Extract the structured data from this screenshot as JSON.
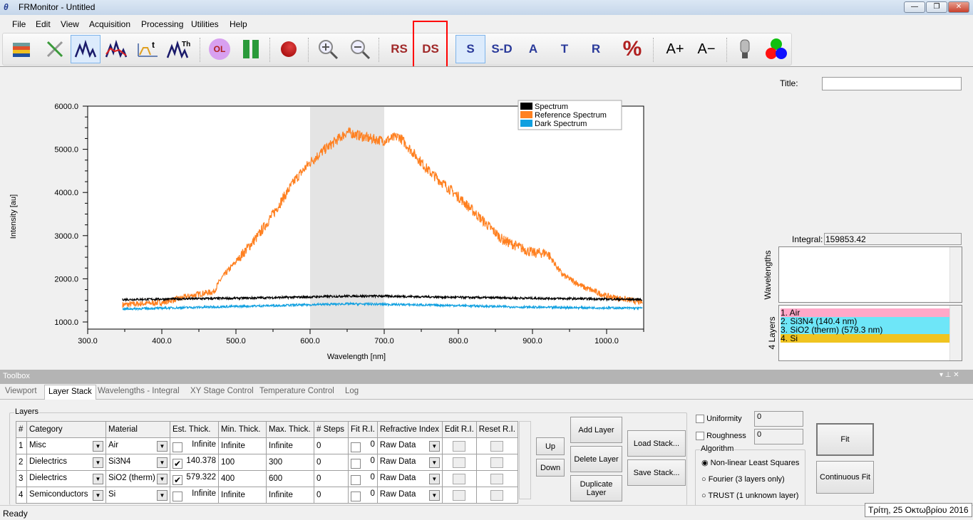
{
  "window": {
    "title": "FRMonitor - Untitled",
    "minimize": "—",
    "maximize": "❐",
    "close": "✕"
  },
  "menu": [
    "File",
    "Edit",
    "View",
    "Acquisition",
    "Processing",
    "Utilities",
    "Help"
  ],
  "toolbar": {
    "rs": "RS",
    "ds": "DS",
    "s": "S",
    "sd": "S-D",
    "a": "A",
    "t": "T",
    "r": "R",
    "percent": "%",
    "font_up": "A+",
    "font_down": "A−",
    "ol": "OL",
    "th": "Th",
    "icons": [
      "layers-icon",
      "tools-icon",
      "spectrum-icon",
      "reflectance-icon",
      "time-spectrum-icon",
      "thickness-spectrum-icon",
      "overlay-icon",
      "pause-icon",
      "record-icon",
      "zoom-in-icon",
      "zoom-out-icon",
      "lamp-icon",
      "rgb-icon"
    ],
    "highlight_color": "#ff0000"
  },
  "side": {
    "title_label": "Title:",
    "title_value": "",
    "integral_label": "Integral:",
    "integral_value": "159853.42",
    "wavelengths_label": "Wavelengths",
    "layers_label": "4 Layers",
    "layers": [
      {
        "text": "1. Air",
        "color": "#ffa8c8"
      },
      {
        "text": "2. Si3N4 (140.4 nm)",
        "color": "#6ee6f8"
      },
      {
        "text": "3. SiO2 (therm) (579.3 nm)",
        "color": "#6ee6f8"
      },
      {
        "text": "4. Si",
        "color": "#f0c420"
      }
    ]
  },
  "chart_data": {
    "type": "line",
    "xlabel": "Wavelength [nm]",
    "ylabel": "Intensity [au]",
    "xlim": [
      300,
      1050
    ],
    "ylim": [
      835,
      6000
    ],
    "xticks": [
      "300.0",
      "400.0",
      "500.0",
      "600.0",
      "700.0",
      "800.0",
      "900.0",
      "1000.0"
    ],
    "yticks": [
      "1000.0",
      "2000.0",
      "3000.0",
      "4000.0",
      "5000.0",
      "6000.0"
    ],
    "highlight_band": [
      600,
      700
    ],
    "legend_position": "top-right",
    "grid": false,
    "series": [
      {
        "name": "Spectrum",
        "color": "#000000",
        "x": [
          347,
          400,
          500,
          600,
          650,
          700,
          800,
          900,
          1050
        ],
        "y": [
          1520,
          1530,
          1550,
          1580,
          1600,
          1600,
          1570,
          1550,
          1520
        ]
      },
      {
        "name": "Reference Spectrum",
        "color": "#ff8020",
        "x": [
          347,
          400,
          450,
          470,
          480,
          500,
          530,
          550,
          580,
          600,
          620,
          650,
          680,
          700,
          720,
          740,
          760,
          800,
          830,
          860,
          900,
          920,
          940,
          970,
          1000,
          1050
        ],
        "y": [
          1400,
          1450,
          1650,
          1700,
          2000,
          2400,
          3000,
          3500,
          4300,
          4700,
          5000,
          5400,
          5250,
          5200,
          5300,
          4900,
          4500,
          3900,
          3400,
          2900,
          2600,
          2600,
          2100,
          1800,
          1600,
          1450
        ]
      },
      {
        "name": "Dark Spectrum",
        "color": "#10a0e0",
        "x": [
          347,
          450,
          600,
          650,
          700,
          800,
          900,
          1050
        ],
        "y": [
          1300,
          1340,
          1400,
          1420,
          1410,
          1380,
          1340,
          1320
        ]
      }
    ]
  },
  "toolbox": {
    "title": "Toolbox",
    "tabs": [
      "Viewport",
      "Layer Stack",
      "Wavelengths - Integral",
      "XY Stage Control",
      "Temperature Control",
      "Log"
    ],
    "active_tab": "Layer Stack",
    "layers_group": "Layers",
    "columns": [
      "#",
      "Category",
      "Material",
      "Est. Thick.",
      "Min. Thick.",
      "Max. Thick.",
      "# Steps",
      "Fit R.I.",
      "Refractive Index",
      "Edit R.I.",
      "Reset R.I."
    ],
    "rows": [
      {
        "n": "1",
        "category": "Misc",
        "material": "Air",
        "est_checked": false,
        "est": "Infinite",
        "min": "Infinite",
        "max": "Infinite",
        "steps": "0",
        "fit": "0",
        "ri": "Raw Data"
      },
      {
        "n": "2",
        "category": "Dielectrics",
        "material": "Si3N4",
        "est_checked": true,
        "est": "140.378",
        "min": "100",
        "max": "300",
        "steps": "0",
        "fit": "0",
        "ri": "Raw Data"
      },
      {
        "n": "3",
        "category": "Dielectrics",
        "material": "SiO2 (therm)",
        "est_checked": true,
        "est": "579.322",
        "min": "400",
        "max": "600",
        "steps": "0",
        "fit": "0",
        "ri": "Raw Data"
      },
      {
        "n": "4",
        "category": "Semiconductors",
        "material": "Si",
        "est_checked": false,
        "est": "Infinite",
        "min": "Infinite",
        "max": "Infinite",
        "steps": "0",
        "fit": "0",
        "ri": "Raw Data"
      }
    ],
    "buttons": {
      "up": "Up",
      "down": "Down",
      "add": "Add Layer",
      "delete": "Delete Layer",
      "duplicate": "Duplicate Layer",
      "load": "Load Stack...",
      "save": "Save Stack...",
      "fit": "Fit",
      "continuous": "Continuous Fit"
    },
    "uniformity": {
      "label": "Uniformity",
      "value": "0",
      "checked": false
    },
    "roughness": {
      "label": "Roughness",
      "value": "0",
      "checked": false
    },
    "algorithm": {
      "label": "Algorithm",
      "options": [
        "Non-linear Least Squares",
        "Fourier (3 layers only)",
        "TRUST (1 unknown layer)"
      ],
      "selected": 0
    }
  },
  "status": {
    "text": "Ready",
    "tooltip": "Τρίτη, 25 Οκτωβρίου 2016"
  }
}
